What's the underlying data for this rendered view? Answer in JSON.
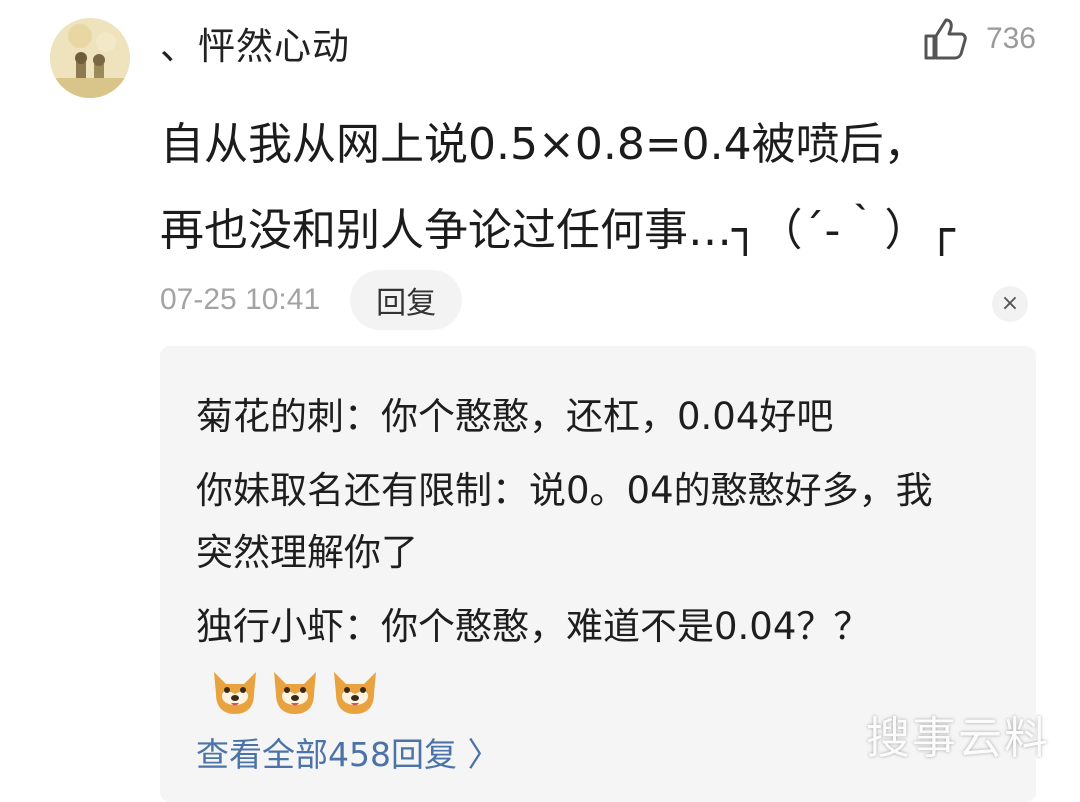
{
  "comment": {
    "username": "、怦然心动",
    "likes": "736",
    "text": "自从我从网上说0.5×0.8=0.4被喷后，\n再也没和别人争论过任何事…┐（´-｀）┌",
    "timestamp": "07-25 10:41",
    "reply_label": "回复",
    "close_label": "×"
  },
  "replies": [
    {
      "author": "菊花的刺",
      "text": "你个憨憨，还杠，0.04好吧"
    },
    {
      "author": "你妹取名还有限制",
      "text": "说0。04的憨憨好多，我突然理解你了"
    },
    {
      "author": "独行小虾",
      "text": "你个憨憨，难道不是0.04？？"
    }
  ],
  "emojis": [
    "shiba-emoji",
    "shiba-emoji",
    "shiba-emoji"
  ],
  "view_all": "查看全部458回复 〉",
  "watermark": "搜事云料",
  "colors": {
    "link": "#4c73a8",
    "reply_bg": "#f5f5f5",
    "muted": "#a3a3a3"
  }
}
